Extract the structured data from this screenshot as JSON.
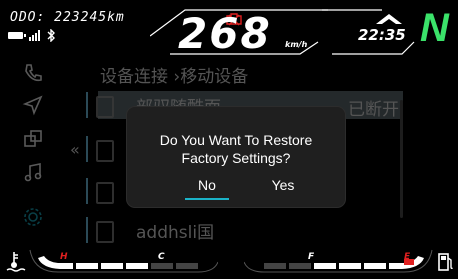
{
  "top_bar": {
    "odometer": "ODO: 223245km",
    "speed": "268",
    "speed_unit": "km/h",
    "clock": "22:35",
    "gear": "N"
  },
  "menu": {
    "title": "设备连接 ›移动设备",
    "items": [
      {
        "label": "部驭随酷面",
        "status": "已断开"
      },
      {
        "label": ""
      },
      {
        "label": ""
      },
      {
        "label": "addhsli国"
      }
    ],
    "back_label": "«"
  },
  "dialog": {
    "message_line1": "Do You Want To Restore",
    "message_line2": "Factory Settings?",
    "no_label": "No",
    "yes_label": "Yes"
  },
  "gauges": {
    "temp_high": "H",
    "temp_low": "C",
    "fuel_full": "F",
    "fuel_empty": "E"
  },
  "colors": {
    "accent": "#1bb3c8",
    "gear": "#3be26a",
    "warning": "#e02020"
  },
  "icons": [
    "battery-icon",
    "signal-icon",
    "bluetooth-icon",
    "engine-warning-icon",
    "up-arrow-icon",
    "phone-icon",
    "navigation-icon",
    "apps-icon",
    "music-icon",
    "settings-icon",
    "coolant-temp-icon",
    "fuel-pump-icon"
  ]
}
